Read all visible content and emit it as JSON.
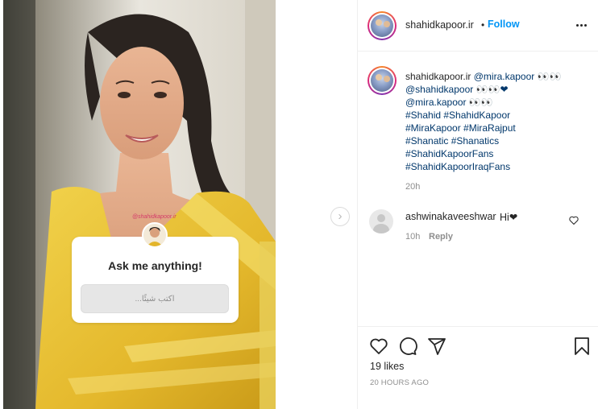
{
  "post": {
    "username": "shahidkapoor.ir",
    "follow_label": "Follow",
    "separator": "•",
    "caption": {
      "username": "shahidkapoor.ir",
      "lines": [
        "@mira.kapoor 👀👀",
        "@shahidkapoor 👀👀❤",
        "@mira.kapoor 👀👀",
        "#Shahid #ShahidKapoor",
        "#MiraKapoor #MiraRajput",
        "#Shanatic #Shanatics",
        "#ShahidKapoorFans",
        "#ShahidKapoorIraqFans"
      ],
      "time": "20h"
    },
    "comment": {
      "username": "ashwinakaveeshwar",
      "text": "Hi❤",
      "time": "10h",
      "reply_label": "Reply"
    },
    "likes": "19 likes",
    "timestamp": "20 HOURS AGO"
  },
  "story": {
    "watermark": "@shahidkapoor.ir",
    "question_title": "Ask me anything!",
    "question_placeholder": "اكتب شيئًا..."
  },
  "icons": {
    "more": "more-options-icon",
    "like": "heart-icon",
    "comment": "comment-icon",
    "share": "share-icon",
    "save": "bookmark-icon",
    "next": "chevron-right-icon"
  },
  "colors": {
    "link": "#00376b",
    "follow": "#0095f6",
    "muted": "#8e8e8e",
    "text": "#262626",
    "dress": "#e8c23a"
  }
}
